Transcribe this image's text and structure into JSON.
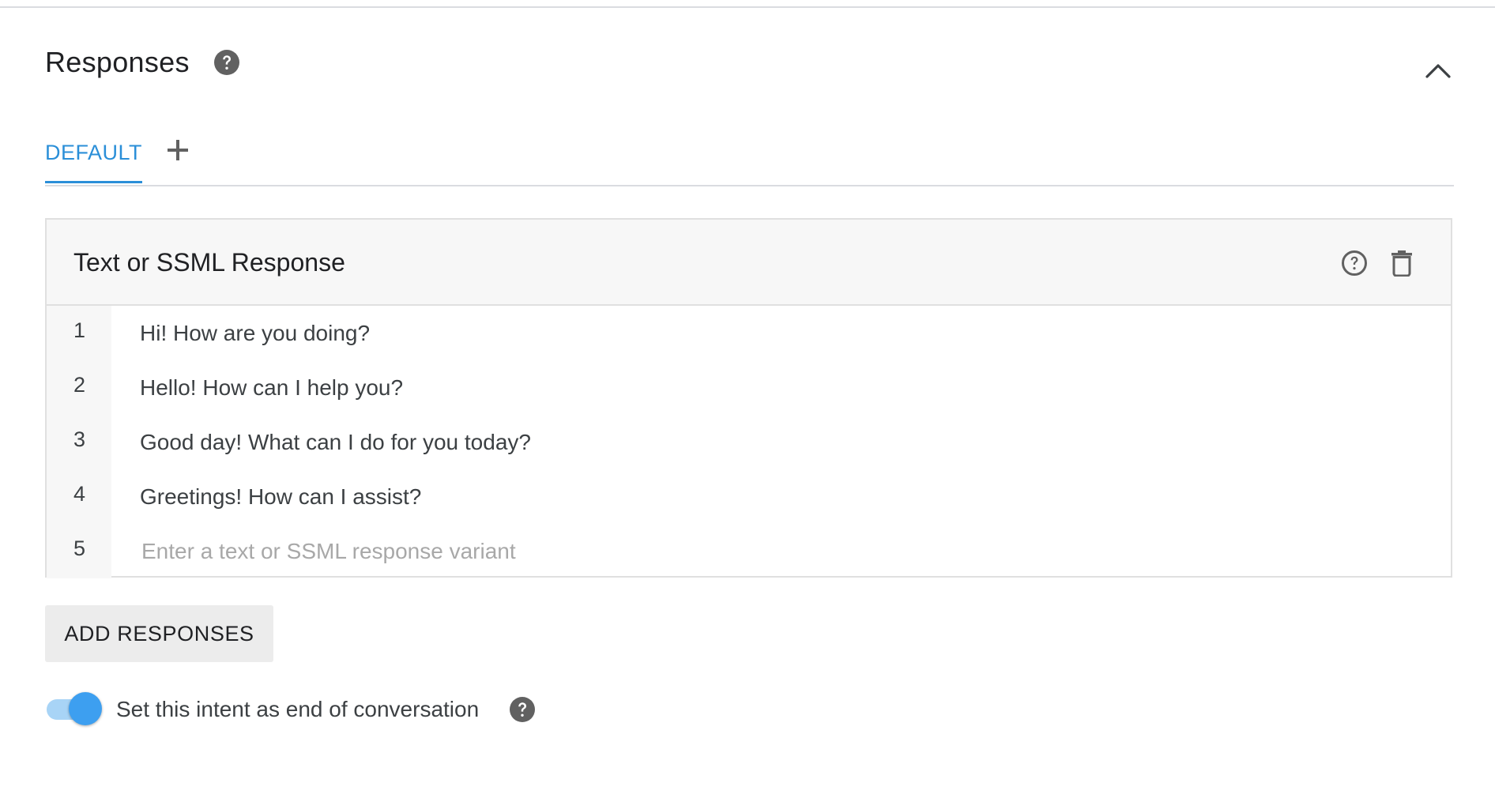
{
  "section": {
    "title": "Responses",
    "help_icon": "help-circle-filled-icon",
    "collapse_icon": "chevron-up-icon"
  },
  "tabs": {
    "items": [
      {
        "label": "DEFAULT",
        "active": true
      }
    ],
    "add_icon": "plus-icon"
  },
  "card": {
    "title": "Text or SSML Response",
    "help_icon": "help-circle-outline-icon",
    "delete_icon": "trash-icon",
    "rows": [
      {
        "num": "1",
        "text": "Hi! How are you doing?"
      },
      {
        "num": "2",
        "text": "Hello! How can I help you?"
      },
      {
        "num": "3",
        "text": "Good day! What can I do for you today?"
      },
      {
        "num": "4",
        "text": "Greetings! How can I assist?"
      }
    ],
    "input_row": {
      "num": "5",
      "value": "",
      "placeholder": "Enter a text or SSML response variant"
    }
  },
  "add_button": {
    "label": "ADD RESPONSES"
  },
  "end_conversation": {
    "label": "Set this intent as end of conversation",
    "enabled": true
  },
  "colors": {
    "accent": "#2b8fd8",
    "toggle_thumb": "#3d9ff0",
    "toggle_track": "#a8d4f6",
    "icon_gray": "#616161"
  }
}
